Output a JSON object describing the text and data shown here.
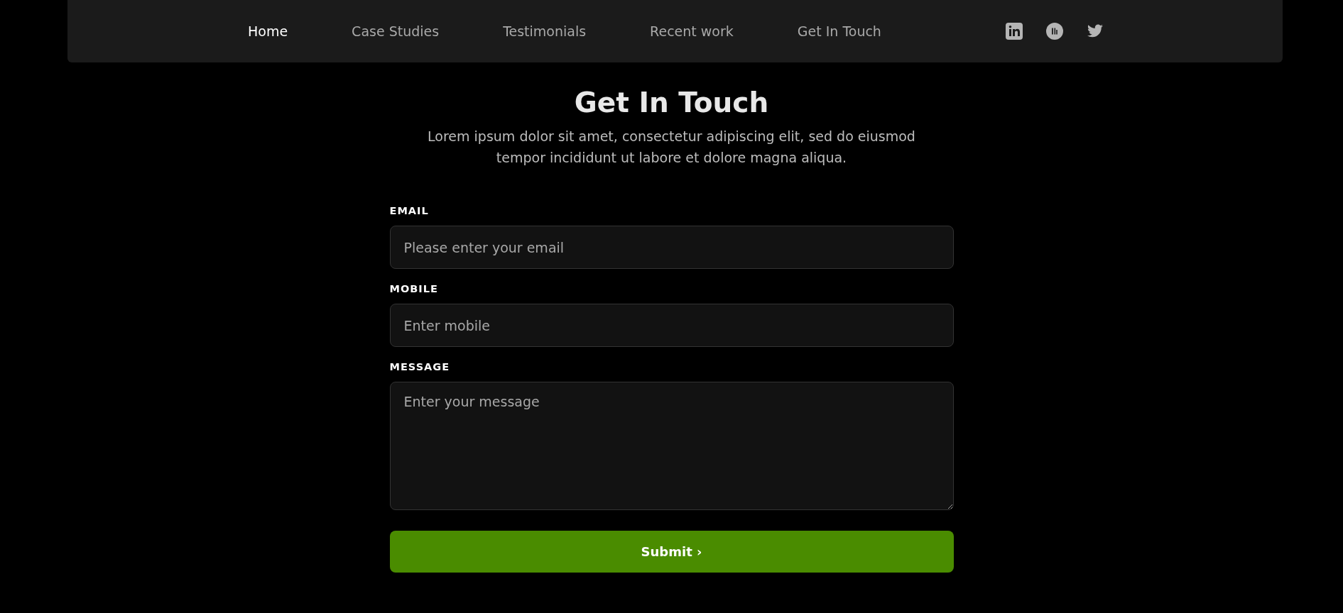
{
  "nav": {
    "items": [
      {
        "label": "Home",
        "selected": true
      },
      {
        "label": "Case Studies",
        "selected": false
      },
      {
        "label": "Testimonials",
        "selected": false
      },
      {
        "label": "Recent work",
        "selected": false
      },
      {
        "label": "Get In Touch",
        "selected": false
      }
    ],
    "social": [
      {
        "kind": "linkedin"
      },
      {
        "kind": "dribbble"
      },
      {
        "kind": "twitter"
      }
    ]
  },
  "heading": "Get In Touch",
  "intro": "Lorem ipsum dolor sit amet, consectetur adipiscing elit, sed do eiusmod tempor incididunt ut labore et dolore magna aliqua.",
  "form": {
    "fields": [
      {
        "label": "EMAIL",
        "kind": "input",
        "placeholder": "Please enter your email"
      },
      {
        "label": "MOBILE",
        "kind": "input",
        "placeholder": "Enter mobile"
      },
      {
        "label": "MESSAGE",
        "kind": "textarea",
        "placeholder": "Enter your message"
      }
    ],
    "submit": "Submit ›"
  }
}
